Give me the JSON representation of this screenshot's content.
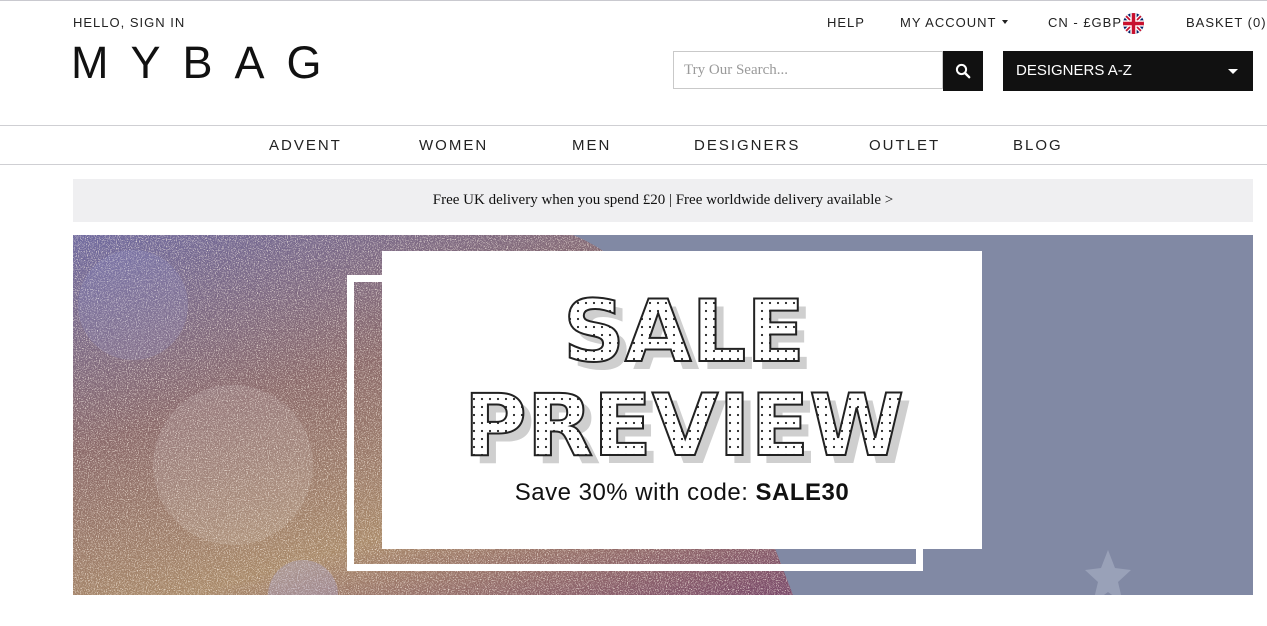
{
  "header": {
    "greeting": "HELLO, SIGN IN",
    "logo": "MYBAG",
    "help": "HELP",
    "my_account": "MY ACCOUNT",
    "currency": "CN - £GBP",
    "basket": "BASKET (0)",
    "flag_icon": "uk-flag-icon"
  },
  "search": {
    "placeholder": "Try Our Search...",
    "button_icon": "search-icon"
  },
  "designers_dropdown": {
    "label": "DESIGNERS A-Z"
  },
  "nav": {
    "items": [
      "ADVENT",
      "WOMEN",
      "MEN",
      "DESIGNERS",
      "OUTLET",
      "BLOG"
    ]
  },
  "promo": {
    "text": "Free UK delivery when you spend £20 | Free worldwide delivery available >"
  },
  "hero": {
    "line1": "SALE",
    "line2": "PREVIEW",
    "sub_prefix": "Save 30% with code: ",
    "code": "SALE30"
  },
  "colors": {
    "black": "#111111",
    "promo_bg": "#efeff1",
    "banner_blue": "#8189a4",
    "glitter_gold": "#b39068"
  }
}
